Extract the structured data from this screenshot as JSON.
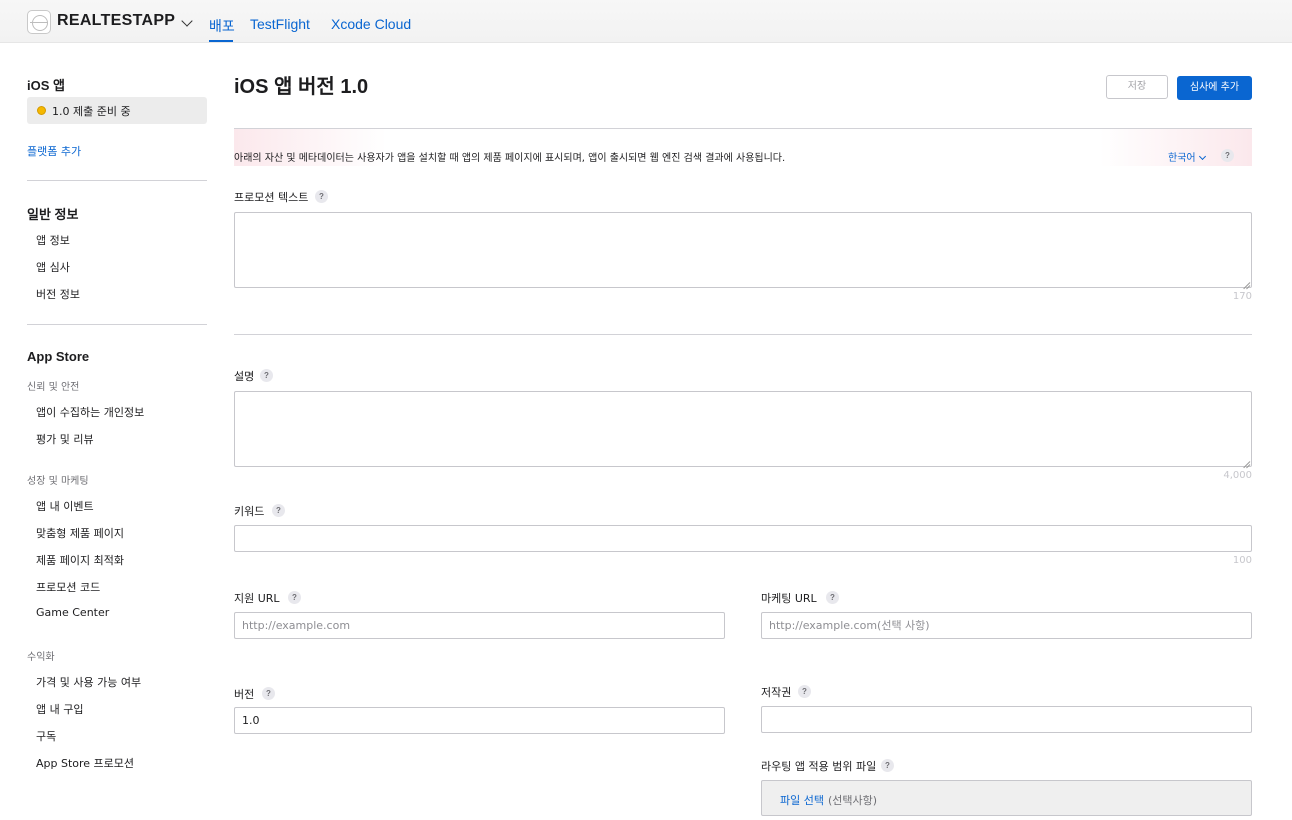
{
  "header": {
    "app_name": "REALTESTAPP",
    "tabs": [
      {
        "label": "배포",
        "active": true
      },
      {
        "label": "TestFlight",
        "active": false
      },
      {
        "label": "Xcode Cloud",
        "active": false
      }
    ]
  },
  "sidebar": {
    "platform_heading": "iOS 앱",
    "version_item": {
      "label": "1.0 제출 준비 중",
      "status_color": "#f5b800"
    },
    "add_platform": "플랫폼 추가",
    "general": {
      "heading": "일반 정보",
      "items": [
        "앱 정보",
        "앱 심사",
        "버전 정보"
      ]
    },
    "app_store": {
      "heading": "App Store",
      "groups": [
        {
          "title": "신뢰 및 안전",
          "items": [
            "앱이 수집하는 개인정보",
            "평가 및 리뷰"
          ]
        },
        {
          "title": "성장 및 마케팅",
          "items": [
            "앱 내 이벤트",
            "맞춤형 제품 페이지",
            "제품 페이지 최적화",
            "프로모션 코드",
            "Game Center"
          ]
        },
        {
          "title": "수익화",
          "items": [
            "가격 및 사용 가능 여부",
            "앱 내 구입",
            "구독",
            "App Store 프로모션"
          ]
        }
      ]
    }
  },
  "main": {
    "title": "iOS 앱 버전 1.0",
    "save_button": "저장",
    "submit_button": "심사에 추가",
    "notice": "아래의 자산 및 메타데이터는 사용자가 앱을 설치할 때 앱의 제품 페이지에 표시되며, 앱이 출시되면 웹 엔진 검색 결과에 사용됩니다.",
    "language": "한국어",
    "help_glyph": "?",
    "fields": {
      "promo_text": {
        "label": "프로모션 텍스트",
        "value": "",
        "limit": "170"
      },
      "description": {
        "label": "설명",
        "value": "",
        "limit": "4,000"
      },
      "keywords": {
        "label": "키워드",
        "value": "",
        "limit": "100"
      },
      "support_url": {
        "label": "지원 URL",
        "value": "",
        "placeholder": "http://example.com"
      },
      "marketing_url": {
        "label": "마케팅 URL",
        "value": "",
        "placeholder": "http://example.com(선택 사항)"
      },
      "version": {
        "label": "버전",
        "value": "1.0"
      },
      "copyright": {
        "label": "저작권",
        "value": ""
      },
      "routing_file": {
        "label": "라우팅 앱 적용 범위 파일",
        "choose": "파일 선택",
        "optional": "(선택사항)"
      }
    }
  },
  "colors": {
    "accent": "#0a66d1",
    "pending": "#f5b800"
  }
}
